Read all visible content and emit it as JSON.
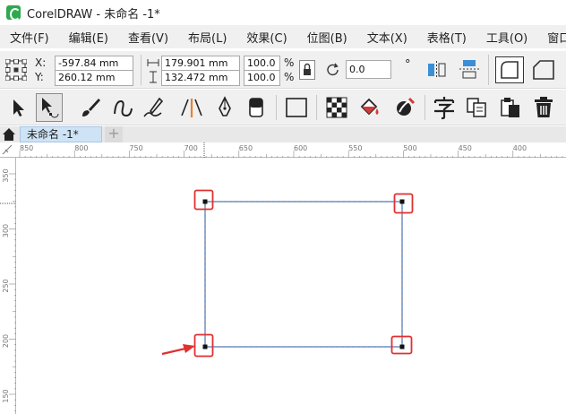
{
  "window": {
    "title": "CorelDRAW - 未命名 -1*"
  },
  "menubar": {
    "items": [
      "文件(F)",
      "编辑(E)",
      "查看(V)",
      "布局(L)",
      "效果(C)",
      "位图(B)",
      "文本(X)",
      "表格(T)",
      "工具(O)",
      "窗口(W)"
    ]
  },
  "propbar": {
    "x_label": "X:",
    "y_label": "Y:",
    "x_value": "-597.84 mm",
    "y_value": "260.12 mm",
    "width_value": "179.901 mm",
    "height_value": "132.472 mm",
    "scale_w": "100.0",
    "scale_h": "100.0",
    "percent": "%",
    "rotation": "0.0",
    "degree": "°"
  },
  "tabs": {
    "document": "未命名 -1*",
    "add": "+"
  },
  "ruler_top": {
    "labels": [
      "850",
      "800",
      "750",
      "700",
      "650",
      "600",
      "550",
      "500",
      "450",
      "400"
    ]
  },
  "ruler_left": {
    "labels": [
      "350",
      "300",
      "250",
      "200",
      "150"
    ]
  },
  "colors": {
    "selection_outline": "#5b8fd9",
    "handle_highlight": "#e03030",
    "arrow": "#e03030"
  }
}
